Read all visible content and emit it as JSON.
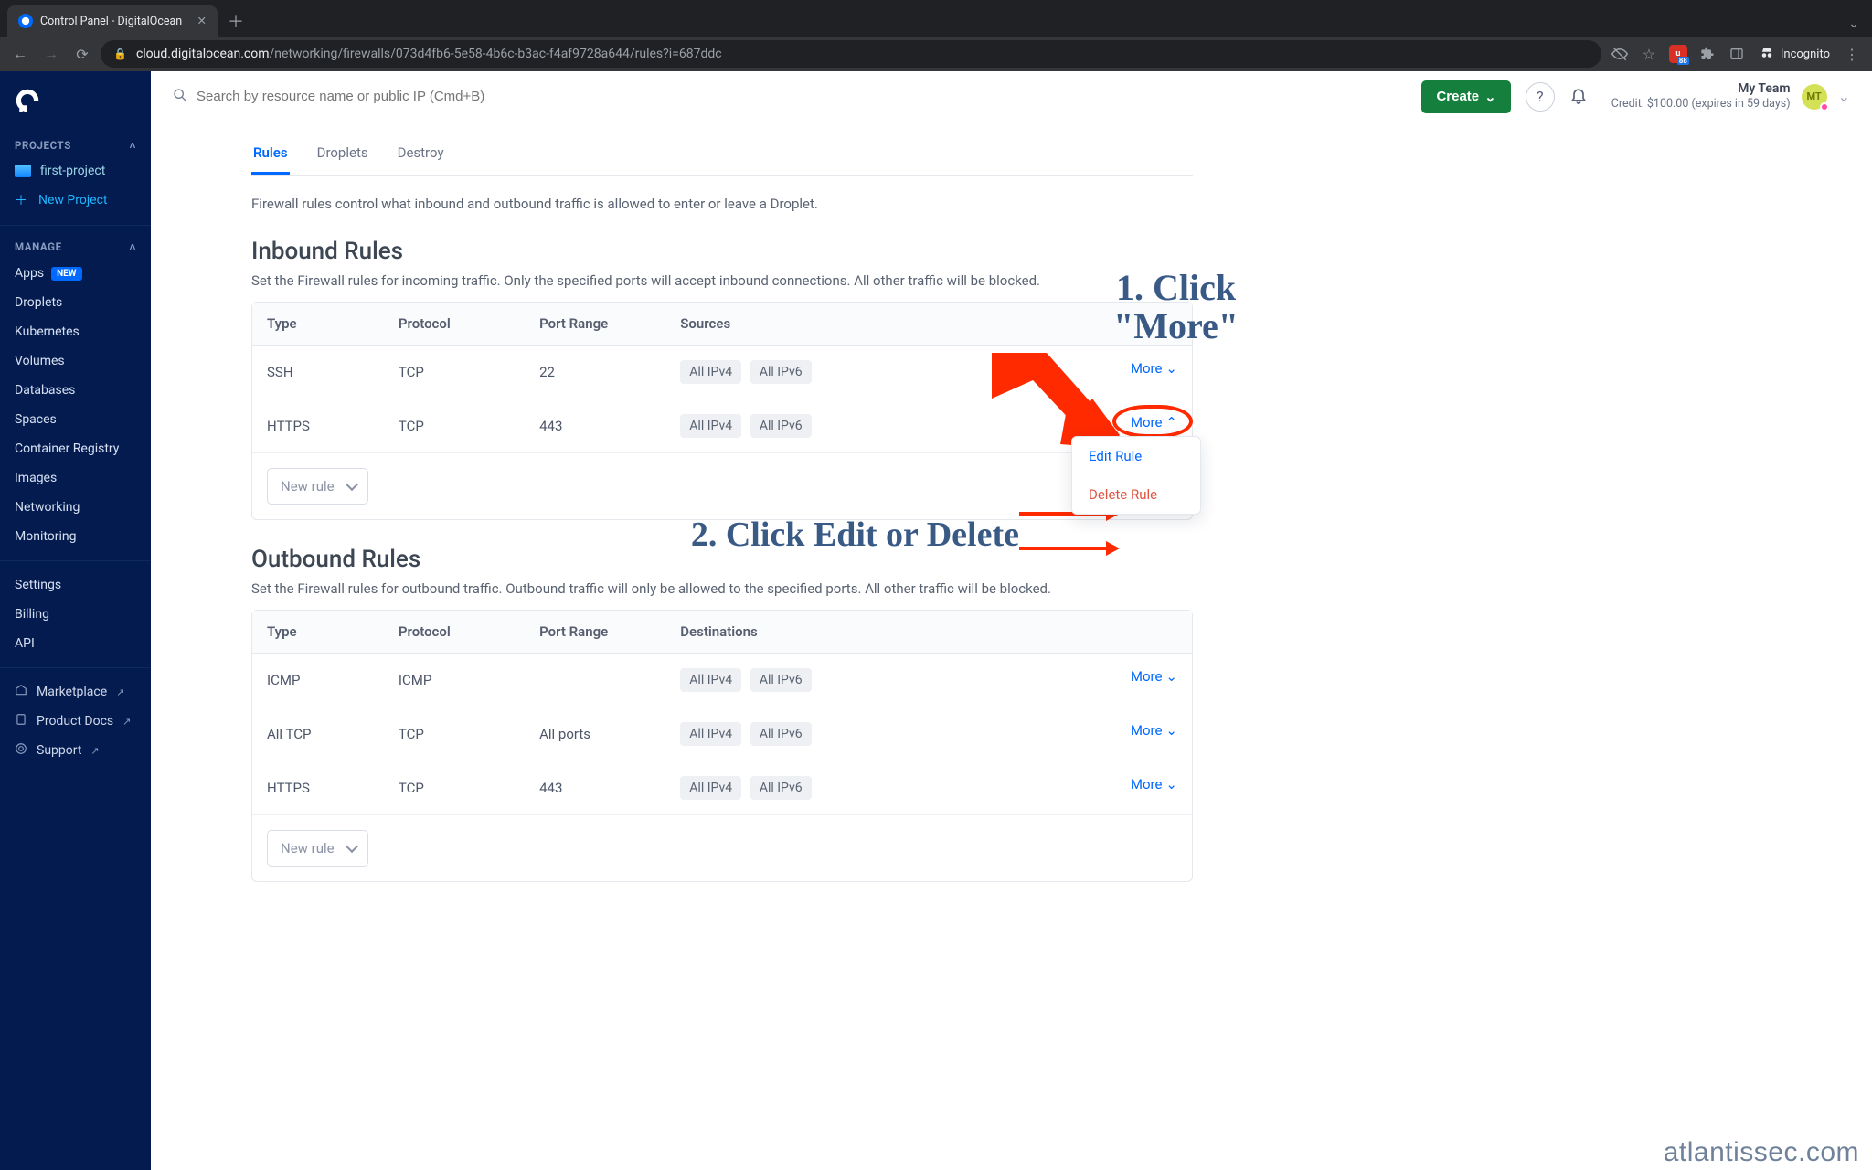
{
  "browser": {
    "tab_title": "Control Panel - DigitalOcean",
    "url_host": "cloud.digitalocean.com",
    "url_path": "/networking/firewalls/073d4fb6-5e58-4b6c-b3ac-f4af9728a644/rules?i=687ddc",
    "incognito_label": "Incognito",
    "ext_badge_count": "88"
  },
  "sidebar": {
    "projects_heading": "PROJECTS",
    "manage_heading": "MANAGE",
    "project_name": "first-project",
    "new_project": "New Project",
    "new_badge": "NEW",
    "manage_items": [
      "Apps",
      "Droplets",
      "Kubernetes",
      "Volumes",
      "Databases",
      "Spaces",
      "Container Registry",
      "Images",
      "Networking",
      "Monitoring"
    ],
    "account_items": [
      "Settings",
      "Billing",
      "API"
    ],
    "footer_items": [
      "Marketplace",
      "Product Docs",
      "Support"
    ]
  },
  "topbar": {
    "search_placeholder": "Search by resource name or public IP (Cmd+B)",
    "create_label": "Create",
    "team_name": "My Team",
    "credit_line": "Credit: $100.00 (expires in 59 days)",
    "avatar_initials": "MT"
  },
  "tabs": [
    "Rules",
    "Droplets",
    "Destroy"
  ],
  "intro": "Firewall rules control what inbound and outbound traffic is allowed to enter or leave a Droplet.",
  "inbound": {
    "title": "Inbound Rules",
    "sub": "Set the Firewall rules for incoming traffic. Only the specified ports will accept inbound connections. All other traffic will be blocked.",
    "headers": [
      "Type",
      "Protocol",
      "Port Range",
      "Sources"
    ],
    "rows": [
      {
        "type": "SSH",
        "protocol": "TCP",
        "port": "22",
        "targets": [
          "All IPv4",
          "All IPv6"
        ]
      },
      {
        "type": "HTTPS",
        "protocol": "TCP",
        "port": "443",
        "targets": [
          "All IPv4",
          "All IPv6"
        ]
      }
    ],
    "more_label": "More",
    "new_rule_label": "New rule",
    "dropdown": {
      "edit": "Edit Rule",
      "delete": "Delete Rule"
    }
  },
  "outbound": {
    "title": "Outbound Rules",
    "sub": "Set the Firewall rules for outbound traffic. Outbound traffic will only be allowed to the specified ports. All other traffic will be blocked.",
    "headers": [
      "Type",
      "Protocol",
      "Port Range",
      "Destinations"
    ],
    "rows": [
      {
        "type": "ICMP",
        "protocol": "ICMP",
        "port": "",
        "targets": [
          "All IPv4",
          "All IPv6"
        ]
      },
      {
        "type": "All TCP",
        "protocol": "TCP",
        "port": "All ports",
        "targets": [
          "All IPv4",
          "All IPv6"
        ]
      },
      {
        "type": "HTTPS",
        "protocol": "TCP",
        "port": "443",
        "targets": [
          "All IPv4",
          "All IPv6"
        ]
      }
    ],
    "more_label": "More",
    "new_rule_label": "New rule"
  },
  "annotations": {
    "step1": "1. Click\n\"More\"",
    "step2": "2. Click Edit or Delete",
    "watermark": "atlantissec.com"
  }
}
